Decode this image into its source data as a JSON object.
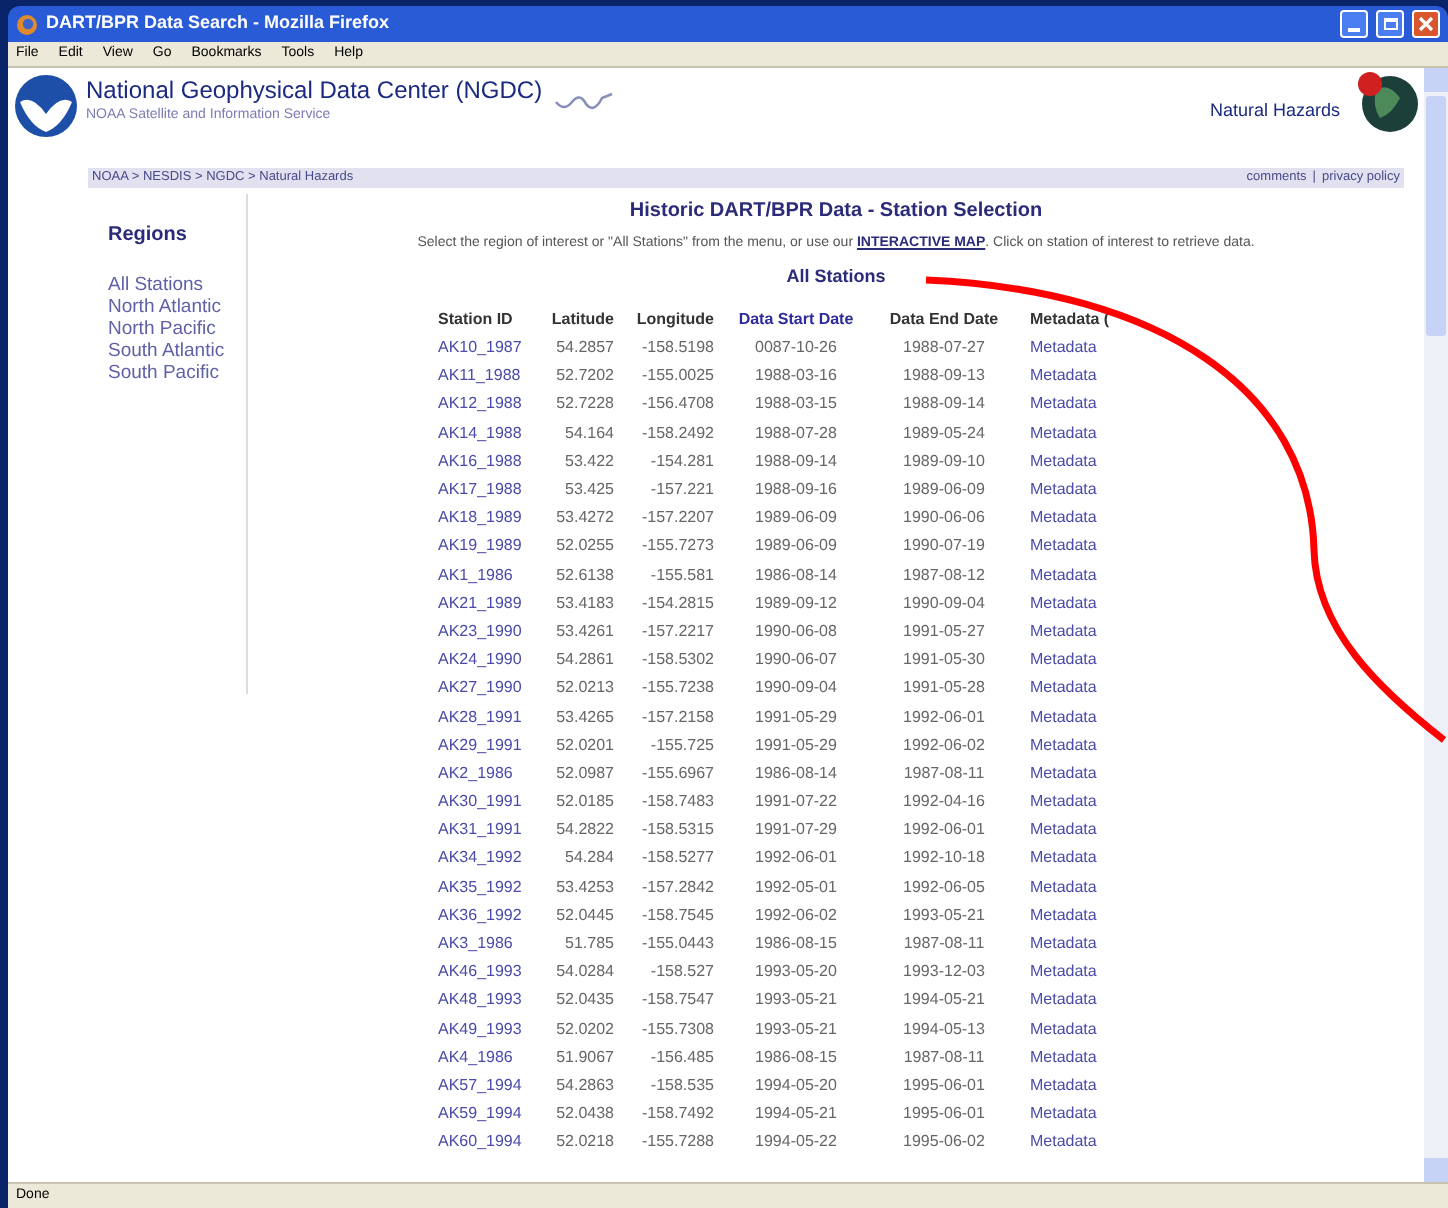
{
  "window": {
    "title": "DART/BPR Data Search - Mozilla Firefox"
  },
  "menu": [
    "File",
    "Edit",
    "View",
    "Go",
    "Bookmarks",
    "Tools",
    "Help"
  ],
  "header": {
    "org_name": "National Geophysical Data Center (NGDC)",
    "subtitle": "NOAA Satellite and Information Service",
    "section": "Natural Hazards",
    "breadcrumb": "NOAA > NESDIS > NGDC > Natural Hazards",
    "links": [
      "comments",
      "privacy policy"
    ],
    "links_separator": "|"
  },
  "sidebar": {
    "title": "Regions",
    "items": [
      "All Stations",
      "North Atlantic",
      "North Pacific",
      "South Atlantic",
      "South Pacific"
    ]
  },
  "main": {
    "title": "Historic DART/BPR Data - Station Selection",
    "intro_before": "Select the region of interest or \"All Stations\" from the menu, or use our",
    "intro_link": "INTERACTIVE MAP",
    "intro_after": ". Click on station of interest to retrieve data.",
    "subtitle": "All Stations"
  },
  "table": {
    "columns": [
      "Station ID",
      "Latitude",
      "Longitude",
      "Data Start Date",
      "Data End Date",
      "Metadata ("
    ],
    "rows": [
      [
        "AK10_1987",
        "54.2857",
        "-158.5198",
        "0087-10-26",
        "1988-07-27",
        "Metadata"
      ],
      [
        "AK11_1988",
        "52.7202",
        "-155.0025",
        "1988-03-16",
        "1988-09-13",
        "Metadata"
      ],
      [
        "AK12_1988",
        "52.7228",
        "-156.4708",
        "1988-03-15",
        "1988-09-14",
        "Metadata"
      ],
      [
        "AK14_1988",
        "54.164",
        "-158.2492",
        "1988-07-28",
        "1989-05-24",
        "Metadata"
      ],
      [
        "AK16_1988",
        "53.422",
        "-154.281",
        "1988-09-14",
        "1989-09-10",
        "Metadata"
      ],
      [
        "AK17_1988",
        "53.425",
        "-157.221",
        "1988-09-16",
        "1989-06-09",
        "Metadata"
      ],
      [
        "AK18_1989",
        "53.4272",
        "-157.2207",
        "1989-06-09",
        "1990-06-06",
        "Metadata"
      ],
      [
        "AK19_1989",
        "52.0255",
        "-155.7273",
        "1989-06-09",
        "1990-07-19",
        "Metadata"
      ],
      [
        "AK1_1986",
        "52.6138",
        "-155.581",
        "1986-08-14",
        "1987-08-12",
        "Metadata"
      ],
      [
        "AK21_1989",
        "53.4183",
        "-154.2815",
        "1989-09-12",
        "1990-09-04",
        "Metadata"
      ],
      [
        "AK23_1990",
        "53.4261",
        "-157.2217",
        "1990-06-08",
        "1991-05-27",
        "Metadata"
      ],
      [
        "AK24_1990",
        "54.2861",
        "-158.5302",
        "1990-06-07",
        "1991-05-30",
        "Metadata"
      ],
      [
        "AK27_1990",
        "52.0213",
        "-155.7238",
        "1990-09-04",
        "1991-05-28",
        "Metadata"
      ],
      [
        "AK28_1991",
        "53.4265",
        "-157.2158",
        "1991-05-29",
        "1992-06-01",
        "Metadata"
      ],
      [
        "AK29_1991",
        "52.0201",
        "-155.725",
        "1991-05-29",
        "1992-06-02",
        "Metadata"
      ],
      [
        "AK2_1986",
        "52.0987",
        "-155.6967",
        "1986-08-14",
        "1987-08-11",
        "Metadata"
      ],
      [
        "AK30_1991",
        "52.0185",
        "-158.7483",
        "1991-07-22",
        "1992-04-16",
        "Metadata"
      ],
      [
        "AK31_1991",
        "54.2822",
        "-158.5315",
        "1991-07-29",
        "1992-06-01",
        "Metadata"
      ],
      [
        "AK34_1992",
        "54.284",
        "-158.5277",
        "1992-06-01",
        "1992-10-18",
        "Metadata"
      ],
      [
        "AK35_1992",
        "53.4253",
        "-157.2842",
        "1992-05-01",
        "1992-06-05",
        "Metadata"
      ],
      [
        "AK36_1992",
        "52.0445",
        "-158.7545",
        "1992-06-02",
        "1993-05-21",
        "Metadata"
      ],
      [
        "AK3_1986",
        "51.785",
        "-155.0443",
        "1986-08-15",
        "1987-08-11",
        "Metadata"
      ],
      [
        "AK46_1993",
        "54.0284",
        "-158.527",
        "1993-05-20",
        "1993-12-03",
        "Metadata"
      ],
      [
        "AK48_1993",
        "52.0435",
        "-158.7547",
        "1993-05-21",
        "1994-05-21",
        "Metadata"
      ],
      [
        "AK49_1993",
        "52.0202",
        "-155.7308",
        "1993-05-21",
        "1994-05-13",
        "Metadata"
      ],
      [
        "AK4_1986",
        "51.9067",
        "-156.485",
        "1986-08-15",
        "1987-08-11",
        "Metadata"
      ],
      [
        "AK57_1994",
        "54.2863",
        "-158.535",
        "1994-05-20",
        "1995-06-01",
        "Metadata"
      ],
      [
        "AK59_1994",
        "52.0438",
        "-158.7492",
        "1994-05-21",
        "1995-06-01",
        "Metadata"
      ],
      [
        "AK60_1994",
        "52.0218",
        "-155.7288",
        "1994-05-22",
        "1995-06-02",
        "Metadata"
      ]
    ]
  },
  "status_bar": "Done"
}
